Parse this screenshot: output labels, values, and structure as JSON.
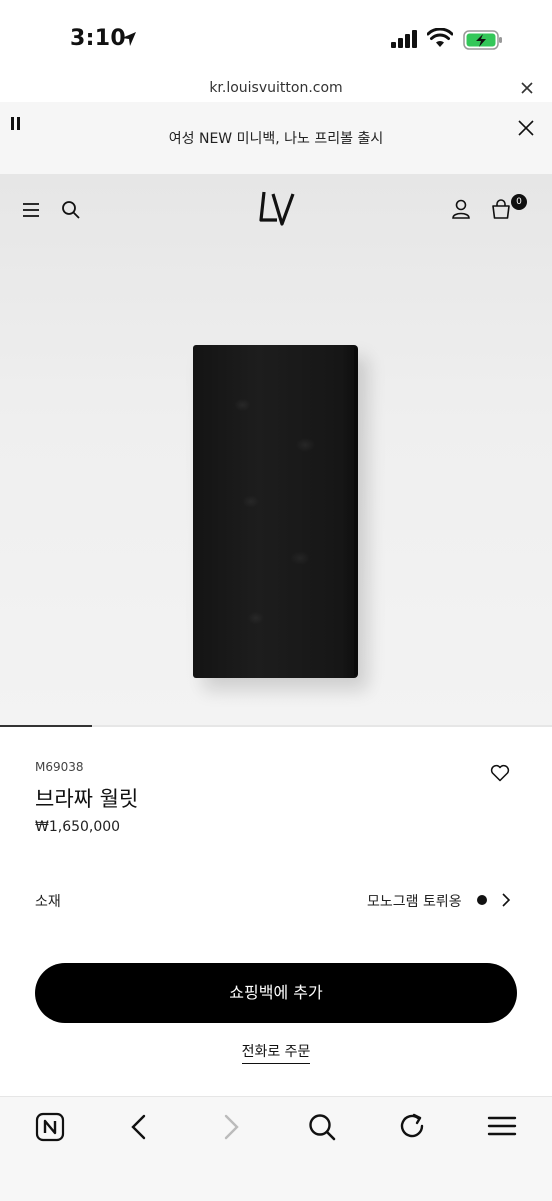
{
  "status_bar": {
    "time": "3:10"
  },
  "browser": {
    "url": "kr.louisvuitton.com"
  },
  "promo": {
    "text": "여성 NEW 미니백, 나노 프리볼 출시"
  },
  "header": {
    "bag_count": "0"
  },
  "gallery": {
    "progress_fraction": 0.167
  },
  "product": {
    "sku": "M69038",
    "name": "브라짜 월릿",
    "price": "₩1,650,000",
    "material_label": "소재",
    "material_value": "모노그램 토뤼옹",
    "add_to_bag_label": "쇼핑백에 추가",
    "phone_order_label": "전화로 주문"
  }
}
